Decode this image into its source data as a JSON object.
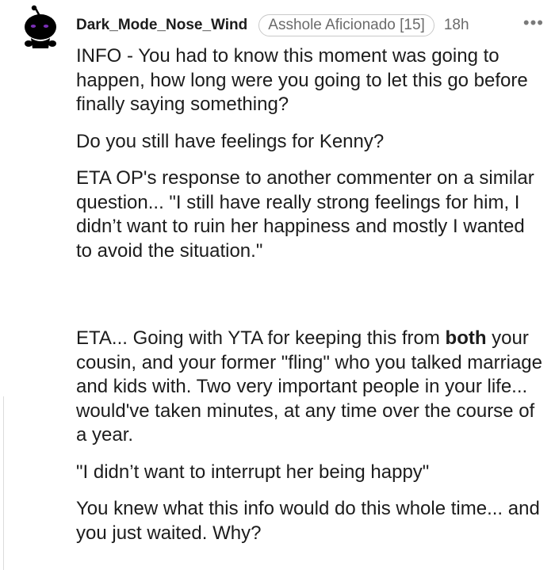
{
  "comment": {
    "username": "Dark_Mode_Nose_Wind",
    "flair": "Asshole Aficionado [15]",
    "age": "18h",
    "more_glyph": "•••",
    "paragraphs": [
      "INFO - You had to know this moment was going to happen, how long were you going to let this go before finally saying something?",
      "Do you still have feelings for Kenny?",
      "ETA OP's response to another commenter on a similar question... \"I still have really strong feelings for him, I didn’t want to ruin her happiness and mostly I wanted to avoid the situation.\"",
      {
        "before": "ETA... Going with YTA for keeping this from ",
        "bold": "both",
        "after": " your cousin, and your former \"fling\" who you talked marriage and kids with. Two very important people in your life... would've taken minutes, at any time over the course of a year."
      },
      "\"I didn’t want to interrupt her being happy\"",
      "You knew what this info would do this whole time... and you just waited. Why?"
    ]
  },
  "colors": {
    "text": "#1c1c1c",
    "meta": "#6b6b6b",
    "avatar_eyes": "#7a2fb5"
  },
  "icons": {
    "avatar": "reddit-snoo-avatar-icon",
    "more": "more-options-icon"
  }
}
